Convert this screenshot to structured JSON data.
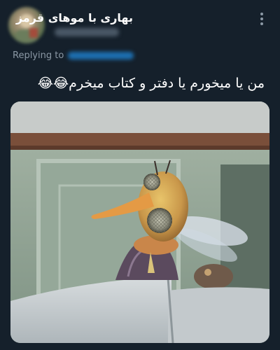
{
  "tweet": {
    "display_name": "بهاری با موهای قرمز",
    "replying_label": "Replying to",
    "text": "من یا میخورم یا دفتر و کتاب میخرم😂😂",
    "avatar_icon": "avatar-photo",
    "more_icon": "more-options-icon",
    "media_icon": "mosquito-puppet-image"
  },
  "colors": {
    "background": "#15202b",
    "text": "#ffffff",
    "secondary_text": "#8b98a5",
    "link": "#1d9bf0"
  }
}
